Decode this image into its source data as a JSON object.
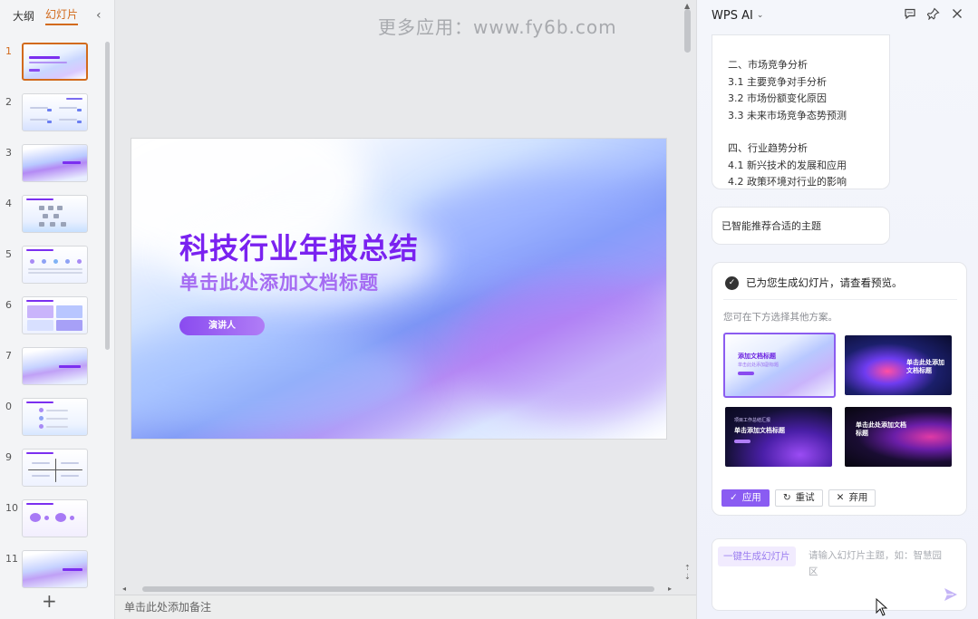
{
  "left_panel": {
    "tabs": [
      {
        "label": "大纲",
        "active": false
      },
      {
        "label": "幻灯片",
        "active": true
      }
    ],
    "collapse_icon": "chevron-left-icon",
    "slides": [
      {
        "number": "1",
        "active": true
      },
      {
        "number": "2",
        "active": false
      },
      {
        "number": "3",
        "active": false
      },
      {
        "number": "4",
        "active": false
      },
      {
        "number": "5",
        "active": false
      },
      {
        "number": "6",
        "active": false
      },
      {
        "number": "7",
        "active": false
      },
      {
        "number": "0",
        "active": false
      },
      {
        "number": "9",
        "active": false
      },
      {
        "number": "10",
        "active": false
      },
      {
        "number": "11",
        "active": false
      }
    ],
    "add_slide_icon": "plus-icon"
  },
  "main": {
    "watermark": "更多应用：www.fy6b.com",
    "slide": {
      "title": "科技行业年报总结",
      "subtitle": "单击此处添加文档标题",
      "presenter_label": "演讲人"
    },
    "notes_placeholder": "单击此处添加备注"
  },
  "ai_panel": {
    "title": "WPS AI",
    "header_icons": [
      "chat-icon",
      "pin-icon",
      "close-icon"
    ],
    "outline_lines": [
      "二、市场竞争分析",
      "3.1 主要竞争对手分析",
      "3.2 市场份额变化原因",
      "3.3 未来市场竞争态势预测",
      "",
      "四、行业趋势分析",
      "4.1 新兴技术的发展和应用",
      "4.2 政策环境对行业的影响"
    ],
    "theme_message": "已智能推荐合适的主题",
    "result": {
      "headline": "已为您生成幻灯片，请查看预览。",
      "hint": "您可在下方选择其他方案。",
      "options": [
        {
          "title": "添加文档标题",
          "subtitle": "单击此处添加副标题",
          "selected": true
        },
        {
          "title": "单击此处添加文档标题",
          "subtitle": "",
          "selected": false
        },
        {
          "title": "单击添加文档标题",
          "subtitle": "项目工作总结汇报",
          "selected": false
        },
        {
          "title": "单击此处添加文档标题",
          "subtitle": "",
          "selected": false
        }
      ],
      "actions": {
        "apply": "应用",
        "retry": "重试",
        "discard": "弃用"
      }
    },
    "input": {
      "chip": "一键生成幻灯片",
      "placeholder": "请输入幻灯片主题，如：智慧园区"
    }
  },
  "colors": {
    "accent_orange": "#d26a1c",
    "accent_purple": "#8a5cf2",
    "title_purple": "#7a22f0"
  }
}
